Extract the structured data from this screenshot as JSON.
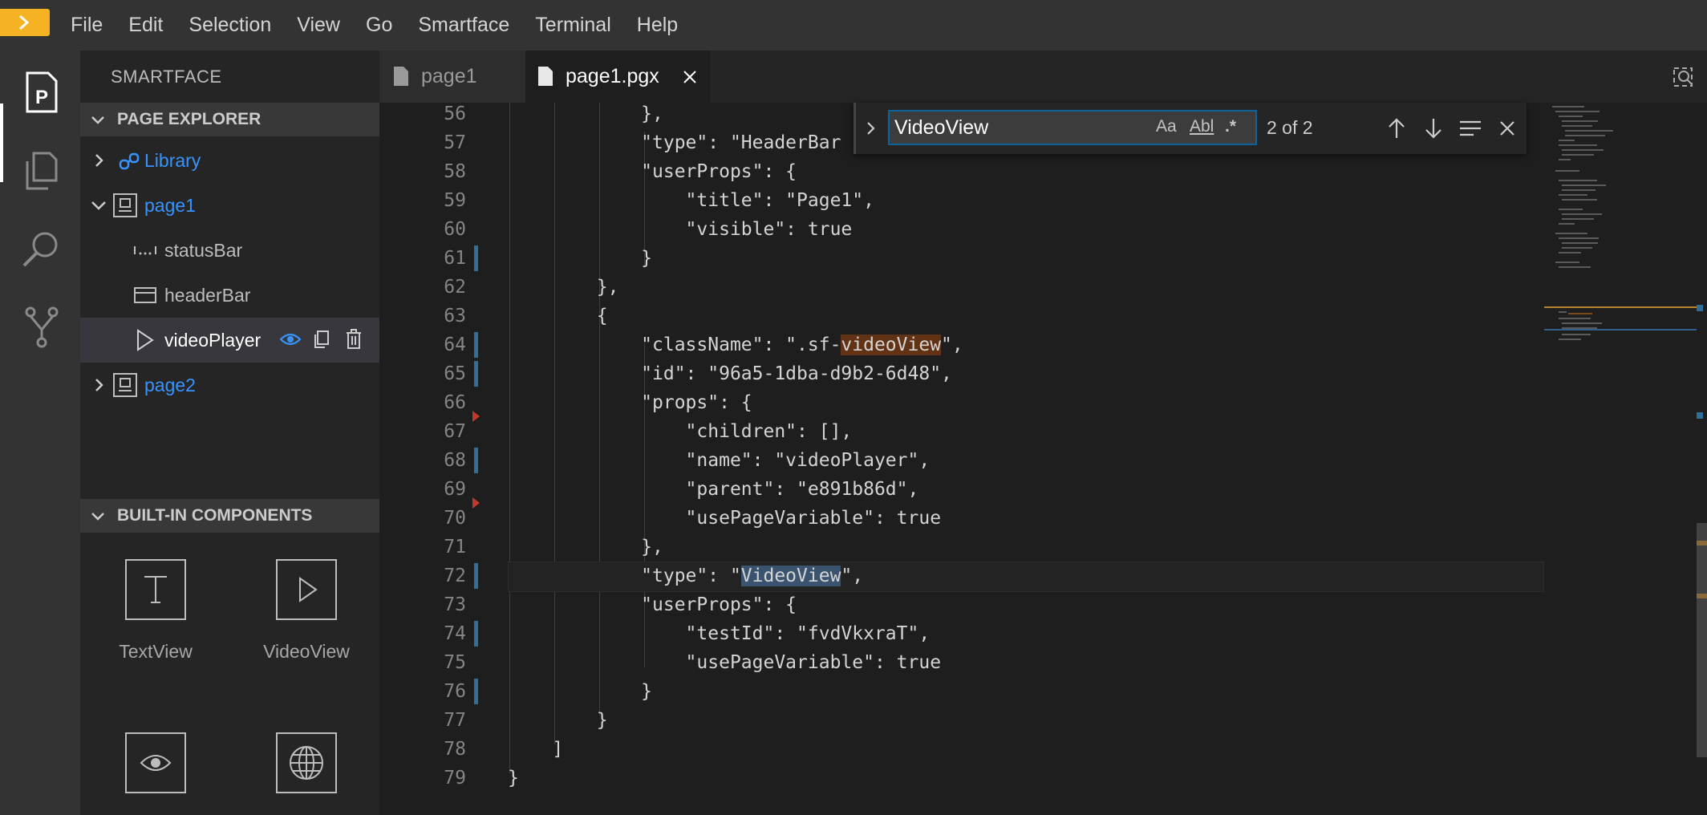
{
  "menu": {
    "items": [
      "File",
      "Edit",
      "Selection",
      "View",
      "Go",
      "Smartface",
      "Terminal",
      "Help"
    ]
  },
  "sidebar": {
    "title": "SMARTFACE",
    "page_explorer": {
      "header": "PAGE EXPLORER",
      "items": [
        {
          "label": "Library",
          "icon": "link-icon"
        },
        {
          "label": "page1",
          "icon": "page-icon"
        },
        {
          "label": "statusBar",
          "icon": "statusbar-icon"
        },
        {
          "label": "headerBar",
          "icon": "headerbar-icon"
        },
        {
          "label": "videoPlayer",
          "icon": "play-icon"
        },
        {
          "label": "page2",
          "icon": "page-icon"
        }
      ]
    },
    "builtin": {
      "header": "BUILT-IN COMPONENTS",
      "components": [
        {
          "label": "TextView",
          "icon": "text-icon"
        },
        {
          "label": "VideoView",
          "icon": "play-icon"
        },
        {
          "label": "",
          "icon": "eye-icon"
        },
        {
          "label": "",
          "icon": "globe-icon"
        }
      ]
    }
  },
  "tabs": [
    {
      "label": "page1"
    },
    {
      "label": "page1.pgx"
    }
  ],
  "find": {
    "value": "VideoView",
    "case_label": "Aa",
    "word_label": "Abl",
    "regex_label": ".*",
    "count": "2 of 2"
  },
  "editor": {
    "lines": [
      {
        "n": "56",
        "text": "            },"
      },
      {
        "n": "57",
        "text": "            \"type\": \"HeaderBar"
      },
      {
        "n": "58",
        "text": "            \"userProps\": {"
      },
      {
        "n": "59",
        "text": "                \"title\": \"Page1\","
      },
      {
        "n": "60",
        "text": "                \"visible\": true"
      },
      {
        "n": "61",
        "text": "            }"
      },
      {
        "n": "62",
        "text": "        },"
      },
      {
        "n": "63",
        "text": "        {"
      },
      {
        "n": "64",
        "text": "            \"className\": \".sf-videoView\","
      },
      {
        "n": "65",
        "text": "            \"id\": \"96a5-1dba-d9b2-6d48\","
      },
      {
        "n": "66",
        "text": "            \"props\": {"
      },
      {
        "n": "67",
        "text": "                \"children\": [],"
      },
      {
        "n": "68",
        "text": "                \"name\": \"videoPlayer\","
      },
      {
        "n": "69",
        "text": "                \"parent\": \"e891b86d\","
      },
      {
        "n": "70",
        "text": "                \"usePageVariable\": true"
      },
      {
        "n": "71",
        "text": "            },"
      },
      {
        "n": "72",
        "text": "            \"type\": \"VideoView\","
      },
      {
        "n": "73",
        "text": "            \"userProps\": {"
      },
      {
        "n": "74",
        "text": "                \"testId\": \"fvdVkxraT\","
      },
      {
        "n": "75",
        "text": "                \"usePageVariable\": true"
      },
      {
        "n": "76",
        "text": "            }"
      },
      {
        "n": "77",
        "text": "        }"
      },
      {
        "n": "78",
        "text": "    ]"
      },
      {
        "n": "79",
        "text": "}"
      }
    ]
  }
}
